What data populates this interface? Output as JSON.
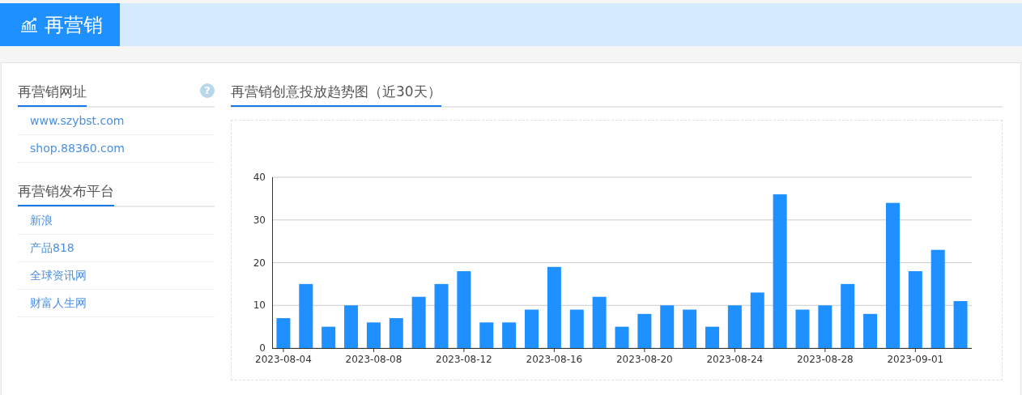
{
  "header": {
    "title": "再营销"
  },
  "sidebar": {
    "sections": [
      {
        "title": "再营销网址",
        "help": "?",
        "items": [
          "www.szybst.com",
          "shop.88360.com"
        ]
      },
      {
        "title": "再营销发布平台",
        "items": [
          "新浪",
          "产品818",
          "全球资讯网",
          "财富人生网"
        ]
      }
    ]
  },
  "main": {
    "title": "再营销创意投放趋势图（近30天）",
    "chart_data": {
      "type": "bar",
      "grid": true,
      "categories": [
        "2023-08-04",
        null,
        null,
        null,
        "2023-08-08",
        null,
        null,
        null,
        "2023-08-12",
        null,
        null,
        null,
        "2023-08-16",
        null,
        null,
        null,
        "2023-08-20",
        null,
        null,
        null,
        "2023-08-24",
        null,
        null,
        null,
        "2023-08-28",
        null,
        null,
        null,
        "2023-09-01",
        null,
        null
      ],
      "series": [
        {
          "color": "#1e90ff",
          "values": [
            7,
            15,
            5,
            10,
            6,
            7,
            12,
            15,
            18,
            6,
            6,
            9,
            19,
            9,
            12,
            5,
            8,
            10,
            9,
            5,
            10,
            13,
            36,
            9,
            10,
            15,
            8,
            34,
            18,
            23,
            11
          ]
        }
      ],
      "ylim": [
        0,
        40
      ],
      "yticks": [
        0,
        10,
        20,
        30,
        40
      ]
    }
  }
}
